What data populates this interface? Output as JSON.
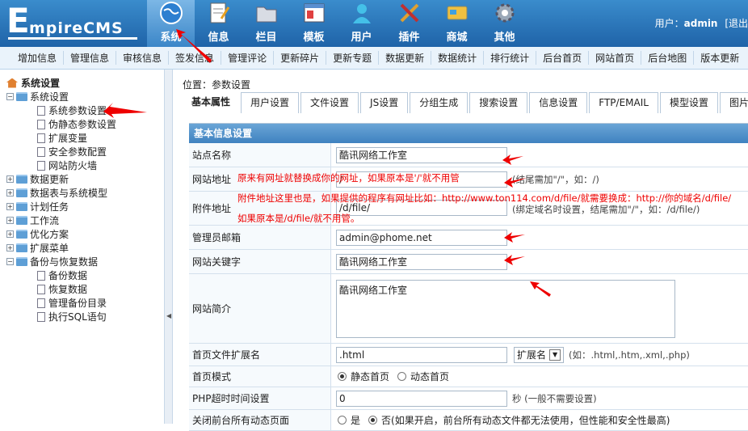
{
  "logo": {
    "letter": "E",
    "rest": "mpireCMS"
  },
  "topnav": [
    {
      "label": "系统",
      "icon": "globe-icon",
      "active": true
    },
    {
      "label": "信息",
      "icon": "notepad-icon"
    },
    {
      "label": "栏目",
      "icon": "folder-icon"
    },
    {
      "label": "模板",
      "icon": "template-window-icon"
    },
    {
      "label": "用户",
      "icon": "user-icon"
    },
    {
      "label": "插件",
      "icon": "tools-icon"
    },
    {
      "label": "商城",
      "icon": "card-icon"
    },
    {
      "label": "其他",
      "icon": "gear-icon"
    }
  ],
  "user": {
    "prefix": "用户：",
    "name": "admin",
    "logout": "[退出"
  },
  "subnav": [
    "增加信息",
    "管理信息",
    "审核信息",
    "签发信息",
    "管理评论",
    "更新碎片",
    "更新专题",
    "数据更新",
    "数据统计",
    "排行统计",
    "后台首页",
    "网站首页",
    "后台地图",
    "版本更新"
  ],
  "sidebar": {
    "root": "系统设置",
    "items": [
      {
        "label": "系统设置",
        "level": 1,
        "pm": "−"
      },
      {
        "label": "系统参数设置",
        "level": 2
      },
      {
        "label": "伪静态参数设置",
        "level": 2
      },
      {
        "label": "扩展变量",
        "level": 2
      },
      {
        "label": "安全参数配置",
        "level": 2
      },
      {
        "label": "网站防火墙",
        "level": 2
      },
      {
        "label": "数据更新",
        "level": 1,
        "pm": "+"
      },
      {
        "label": "数据表与系统模型",
        "level": 1,
        "pm": "+"
      },
      {
        "label": "计划任务",
        "level": 1,
        "pm": "+"
      },
      {
        "label": "工作流",
        "level": 1,
        "pm": "+"
      },
      {
        "label": "优化方案",
        "level": 1,
        "pm": "+"
      },
      {
        "label": "扩展菜单",
        "level": 1,
        "pm": "+"
      },
      {
        "label": "备份与恢复数据",
        "level": 1,
        "pm": "−"
      },
      {
        "label": "备份数据",
        "level": 2
      },
      {
        "label": "恢复数据",
        "level": 2
      },
      {
        "label": "管理备份目录",
        "level": 2
      },
      {
        "label": "执行SQL语句",
        "level": 2
      }
    ]
  },
  "main": {
    "position": "位置：参数设置",
    "tabs": [
      "基本属性",
      "用户设置",
      "文件设置",
      "JS设置",
      "分组生成",
      "搜索设置",
      "信息设置",
      "FTP/EMAIL",
      "模型设置",
      "图片设置"
    ],
    "section_title": "基本信息设置",
    "fields": {
      "site_name": {
        "label": "站点名称",
        "value": "酷讯网络工作室"
      },
      "site_url": {
        "label": "网站地址",
        "value": "/",
        "hint": "(结尾需加\"/\"，如：/)"
      },
      "attach_url": {
        "label": "附件地址",
        "value": "/d/file/",
        "hint": "(绑定域名时设置，结尾需加\"/\"，如：/d/file/)"
      },
      "admin_email": {
        "label": "管理员邮箱",
        "value": "admin@phome.net"
      },
      "keywords": {
        "label": "网站关键字",
        "value": "酷讯网络工作室"
      },
      "description": {
        "label": "网站简介",
        "value": "酷讯网络工作室"
      },
      "index_ext": {
        "label": "首页文件扩展名",
        "value": ".html",
        "select": "扩展名",
        "hint": "(如：.html,.htm,.xml,.php)"
      },
      "index_mode": {
        "label": "首页模式",
        "opt1": "静态首页",
        "opt2": "动态首页"
      },
      "php_timeout": {
        "label": "PHP超时时间设置",
        "value": "0",
        "hint": "秒 (一般不需要设置)"
      },
      "close_dynamic": {
        "label": "关闭前台所有动态页面",
        "opt1": "是",
        "opt2": "否(如果开启，前台所有动态文件都无法使用，但性能和安全性最高)"
      }
    },
    "notes": {
      "n1": "原来有网址就替换成你的网址，如果原本是'/'就不用管",
      "n2": "附件地址这里也是，如果提供的程序有网址比如：http://www.ton114.com/d/file/就需要换成：http://你的域名/d/file/",
      "n3": "如果原本是/d/file/就不用管。"
    }
  },
  "colors": {
    "header": "#1f63a8",
    "note": "#e00000"
  }
}
